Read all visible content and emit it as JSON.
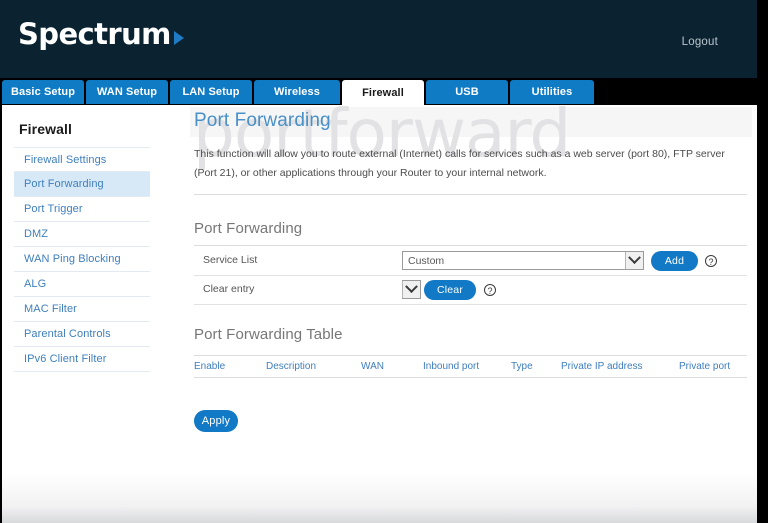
{
  "header": {
    "brand": "Spectrum",
    "logout_label": "Logout",
    "brand_arrow_icon": "triangle-right-icon",
    "bg_color": "#0b2230"
  },
  "tabs": [
    {
      "label": "Basic Setup",
      "active": false
    },
    {
      "label": "WAN Setup",
      "active": false
    },
    {
      "label": "LAN Setup",
      "active": false
    },
    {
      "label": "Wireless",
      "active": false
    },
    {
      "label": "Firewall",
      "active": true
    },
    {
      "label": "USB",
      "active": false
    },
    {
      "label": "Utilities",
      "active": false
    }
  ],
  "sidebar": {
    "title": "Firewall",
    "items": [
      {
        "label": "Firewall Settings",
        "active": false
      },
      {
        "label": "Port Forwarding",
        "active": true
      },
      {
        "label": "Port Trigger",
        "active": false
      },
      {
        "label": "DMZ",
        "active": false
      },
      {
        "label": "WAN Ping Blocking",
        "active": false
      },
      {
        "label": "ALG",
        "active": false
      },
      {
        "label": "MAC Filter",
        "active": false
      },
      {
        "label": "Parental Controls",
        "active": false
      },
      {
        "label": "IPv6 Client Filter",
        "active": false
      }
    ]
  },
  "main": {
    "watermark": "portforward",
    "page_title": "Port Forwarding",
    "intro": "This function will allow you to route external (Internet) calls for services such as a web server (port 80), FTP server (Port 21), or other applications through your Router to your internal network.",
    "section_title": "Port Forwarding",
    "service_list": {
      "label": "Service List",
      "value": "Custom",
      "dropdown_icon": "chevron-down-icon",
      "add_label": "Add",
      "help_icon": "question-mark-icon"
    },
    "clear_entry": {
      "label": "Clear entry",
      "value": "",
      "dropdown_icon": "chevron-down-icon",
      "clear_label": "Clear",
      "help_icon": "question-mark-icon"
    },
    "table": {
      "title": "Port Forwarding Table",
      "columns": [
        "Enable",
        "Description",
        "WAN",
        "Inbound port",
        "Type",
        "Private IP address",
        "Private port"
      ],
      "rows": []
    },
    "apply_label": "Apply"
  },
  "colors": {
    "tab_blue": "#0f7bc4",
    "button_blue": "#1279c6",
    "link_blue": "#3f7fbd",
    "title_blue": "#4a90c8",
    "active_row": "#d7e9f6"
  }
}
